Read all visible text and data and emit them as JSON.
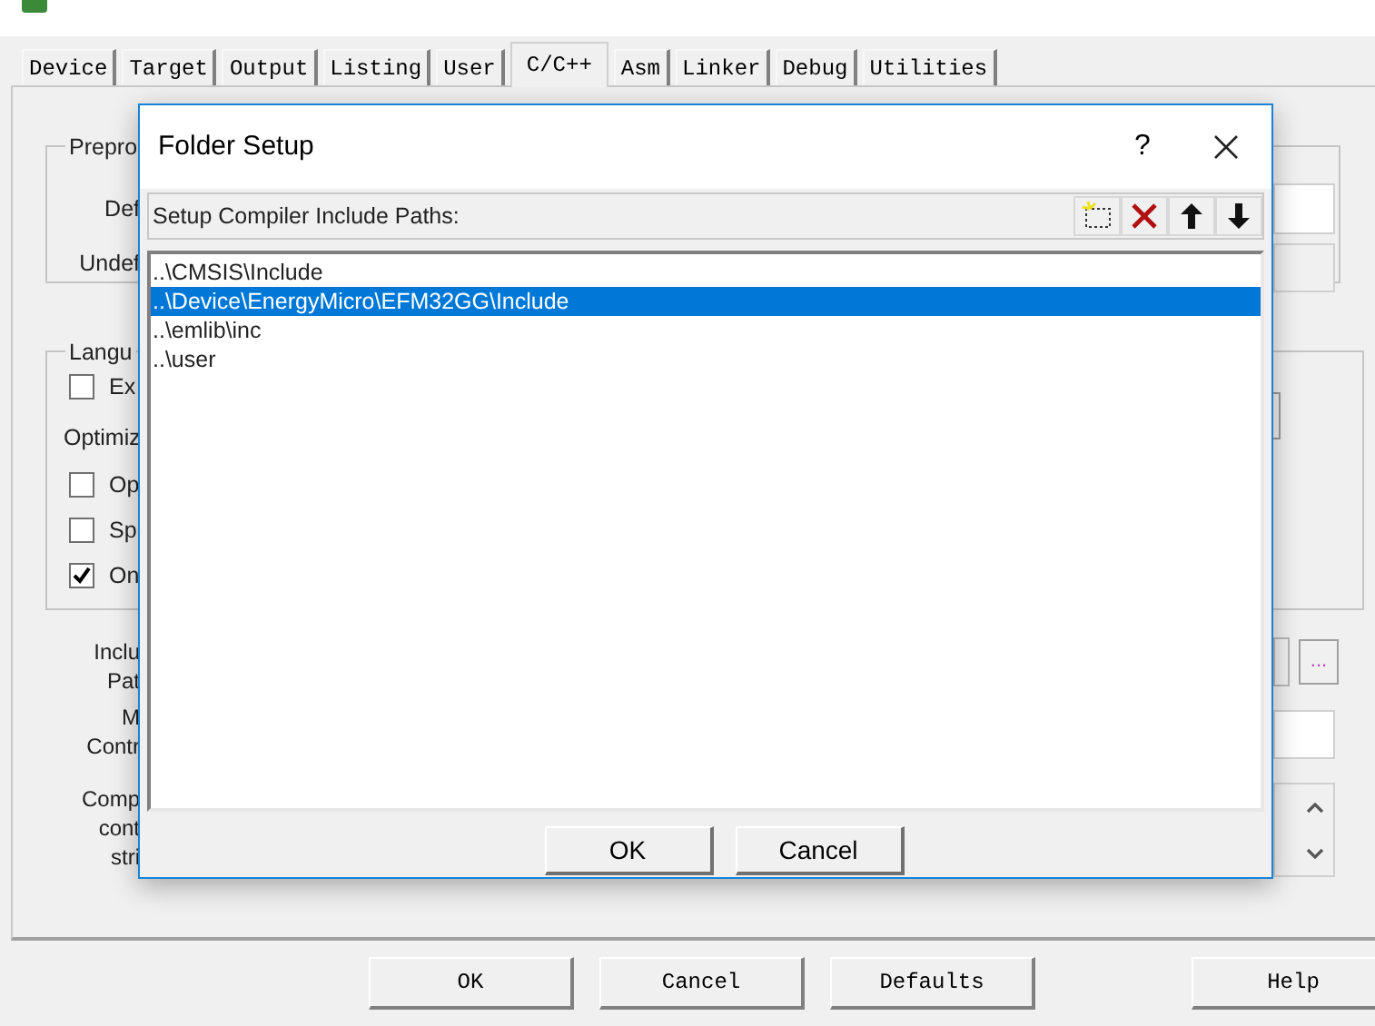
{
  "tabs": [
    {
      "label": "Device",
      "selected": false
    },
    {
      "label": "Target",
      "selected": false
    },
    {
      "label": "Output",
      "selected": false
    },
    {
      "label": "Listing",
      "selected": false
    },
    {
      "label": "User",
      "selected": false
    },
    {
      "label": "C/C++",
      "selected": true
    },
    {
      "label": "Asm",
      "selected": false
    },
    {
      "label": "Linker",
      "selected": false
    },
    {
      "label": "Debug",
      "selected": false
    },
    {
      "label": "Utilities",
      "selected": false
    }
  ],
  "preprocessor_group": {
    "title": "Prepro",
    "labels": [
      "Def",
      "Undef"
    ]
  },
  "language_group": {
    "title": "Langu",
    "options": [
      {
        "label": "Ex",
        "checked": false
      }
    ],
    "optimize_label": "Optimiz",
    "more_options": [
      {
        "label": "Op",
        "checked": false
      },
      {
        "label": "Sp",
        "checked": false
      },
      {
        "label": "On",
        "checked": true
      }
    ]
  },
  "field_labels": [
    {
      "lines": [
        "Inclu",
        "Pat"
      ]
    },
    {
      "lines": [
        "M",
        "Contr"
      ]
    },
    {
      "lines": [
        "Comp",
        "cont",
        "stri"
      ]
    }
  ],
  "browse_button": "...",
  "buttons": [
    "OK",
    "Cancel",
    "Defaults",
    "Help"
  ],
  "dialog": {
    "title": "Folder Setup",
    "help": "?",
    "header": "Setup Compiler Include Paths:",
    "paths": [
      {
        "text": "..\\CMSIS\\Include",
        "selected": false
      },
      {
        "text": "..\\Device\\EnergyMicro\\EFM32GG\\Include",
        "selected": true
      },
      {
        "text": "..\\emlib\\inc",
        "selected": false
      },
      {
        "text": "..\\user",
        "selected": false
      }
    ],
    "buttons": [
      "OK",
      "Cancel"
    ]
  }
}
